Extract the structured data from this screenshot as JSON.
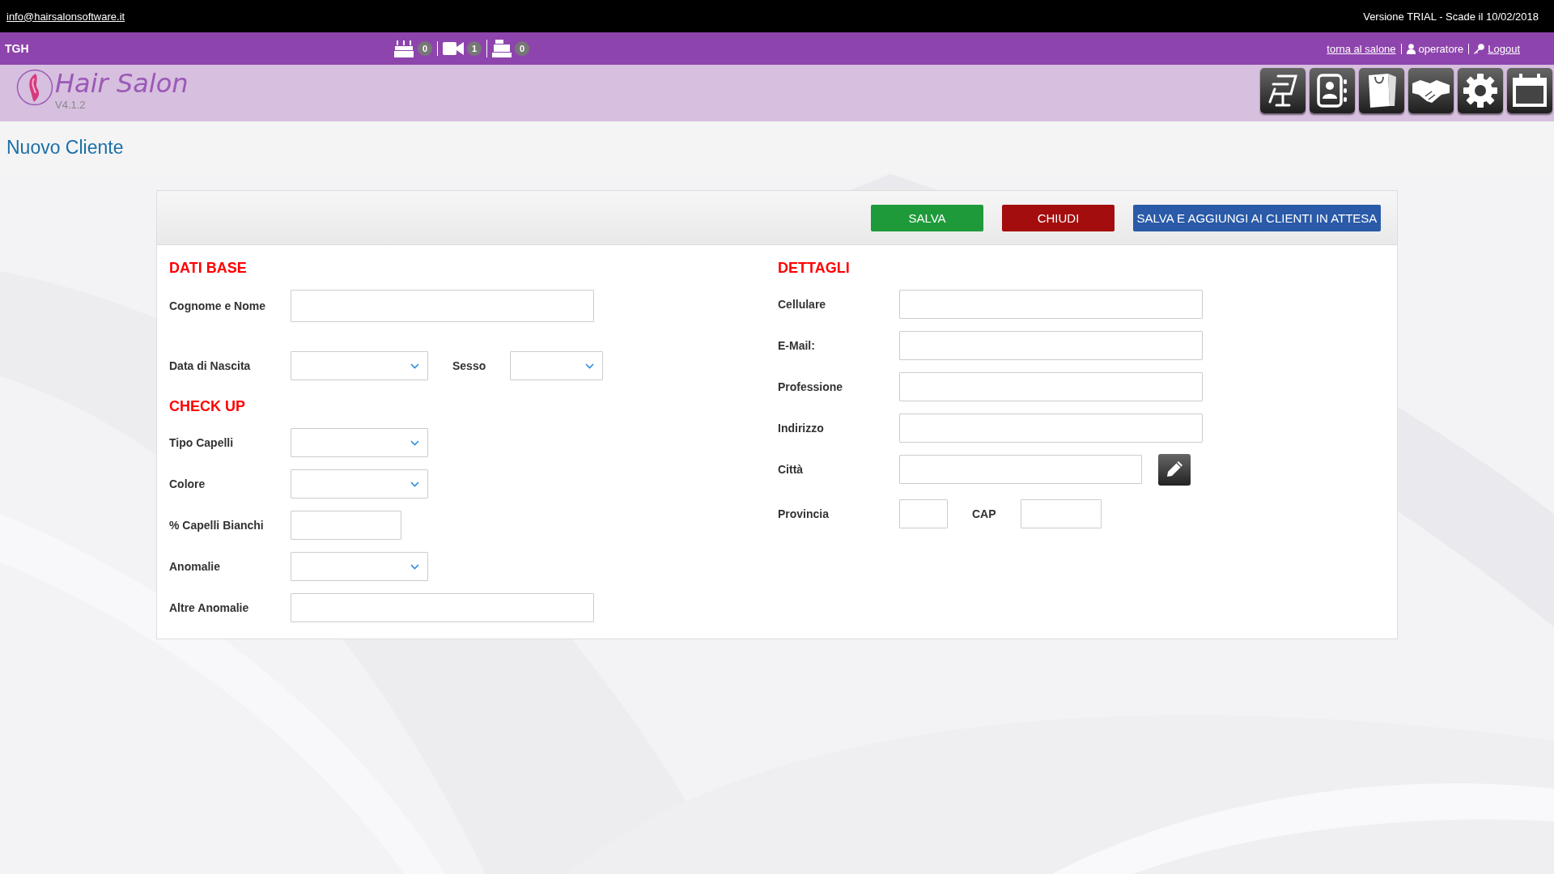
{
  "top_bar": {
    "email": "info@hairsalonsoftware.it",
    "version": "Versione TRIAL - Scade il 10/02/2018"
  },
  "nav_bar": {
    "code": "TGH",
    "counters": [
      {
        "kind": "cake",
        "count": "0"
      },
      {
        "kind": "video",
        "count": "1"
      },
      {
        "kind": "register",
        "count": "0"
      }
    ],
    "back_link": "torna al salone",
    "user": "operatore",
    "logout": "Logout"
  },
  "header": {
    "logo_text": "Hair Salon",
    "version": "V4.1.2",
    "toolbar": [
      {
        "kind": "chair"
      },
      {
        "kind": "contacts"
      },
      {
        "kind": "bag"
      },
      {
        "kind": "handshake"
      },
      {
        "kind": "settings"
      },
      {
        "kind": "calendar"
      }
    ]
  },
  "page_title": "Nuovo Cliente",
  "form": {
    "buttons": [
      {
        "kind": "save",
        "label": "SALVA"
      },
      {
        "kind": "close",
        "label": "CHIUDI"
      },
      {
        "kind": "save_queue",
        "label": "SALVA E AGGIUNGI AI CLIENTI IN ATTESA"
      }
    ],
    "columns": [
      {
        "sections": [
          {
            "title": "DATI BASE",
            "rows": [
              {
                "fields": [
                  {
                    "label": "Cognome e Nome",
                    "kind": "text"
                  }
                ]
              },
              {
                "fields": [
                  {
                    "label": "Data di Nascita",
                    "kind": "select"
                  },
                  {
                    "label": "Sesso",
                    "kind": "select"
                  }
                ]
              }
            ]
          },
          {
            "title": "CHECK UP",
            "rows": [
              {
                "fields": [
                  {
                    "label": "Tipo Capelli",
                    "kind": "select"
                  }
                ]
              },
              {
                "fields": [
                  {
                    "label": "Colore",
                    "kind": "select"
                  }
                ]
              },
              {
                "fields": [
                  {
                    "label": "% Capelli Bianchi",
                    "kind": "text"
                  }
                ]
              },
              {
                "fields": [
                  {
                    "label": "Anomalie",
                    "kind": "select"
                  }
                ]
              },
              {
                "fields": [
                  {
                    "label": "Altre Anomalie",
                    "kind": "text"
                  }
                ]
              }
            ]
          }
        ]
      },
      {
        "sections": [
          {
            "title": "DETTAGLI",
            "rows": [
              {
                "fields": [
                  {
                    "label": "Cellulare",
                    "kind": "text"
                  }
                ]
              },
              {
                "fields": [
                  {
                    "label": "E-Mail:",
                    "kind": "text"
                  }
                ]
              },
              {
                "fields": [
                  {
                    "label": "Professione",
                    "kind": "text"
                  }
                ]
              },
              {
                "fields": [
                  {
                    "label": "Indirizzo",
                    "kind": "text"
                  }
                ]
              },
              {
                "fields": [
                  {
                    "label": "Città",
                    "kind": "text_edit"
                  }
                ]
              },
              {
                "fields": [
                  {
                    "label": "Provincia",
                    "kind": "text"
                  },
                  {
                    "label": "CAP",
                    "kind": "text"
                  }
                ]
              }
            ]
          }
        ]
      }
    ]
  }
}
